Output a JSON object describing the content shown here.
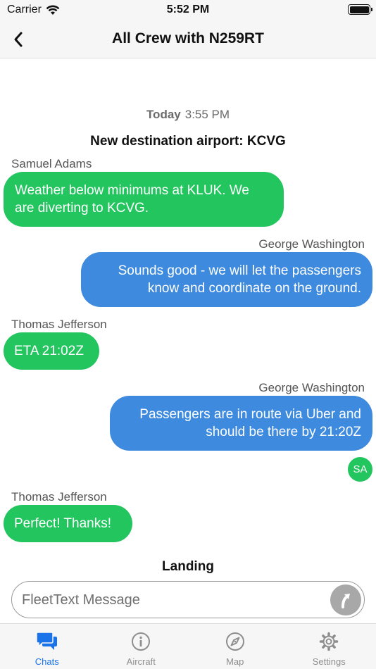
{
  "status": {
    "carrier": "Carrier",
    "time": "5:52 PM",
    "battery_level": 1.0
  },
  "nav": {
    "title": "All Crew with N259RT",
    "back_icon": "chevron-left-icon"
  },
  "chat": {
    "date_day": "Today",
    "date_time": "3:55 PM",
    "event_destination": "New destination airport: KCVG",
    "messages": [
      {
        "sender": "Samuel Adams",
        "side": "left",
        "color": "#22c55e",
        "lines": [
          "Weather below minimums at KLUK. We",
          "are diverting to KCVG."
        ]
      },
      {
        "sender": "George Washington",
        "side": "right",
        "color": "#3d8ade",
        "lines": [
          "Sounds good - we will let the passengers",
          "know and coordinate on the ground."
        ]
      },
      {
        "sender": "Thomas Jefferson",
        "side": "left",
        "color": "#22c55e",
        "lines": [
          "ETA 21:02Z"
        ]
      },
      {
        "sender": "George Washington",
        "side": "right",
        "color": "#3d8ade",
        "lines": [
          "Passengers are in route via Uber and",
          "should be there by 21:20Z"
        ]
      },
      {
        "sender": "Thomas Jefferson",
        "side": "left",
        "color": "#22c55e",
        "lines": [
          "Perfect! Thanks!"
        ]
      }
    ],
    "read_receipt_initials": "SA",
    "event_landing": "Landing"
  },
  "composer": {
    "placeholder": "FleetText Message",
    "send_icon": "send-arrow-icon"
  },
  "tabs": [
    {
      "label": "Chats",
      "icon": "chat-bubbles-icon",
      "active": true
    },
    {
      "label": "Aircraft",
      "icon": "info-circle-icon",
      "active": false
    },
    {
      "label": "Map",
      "icon": "compass-icon",
      "active": false
    },
    {
      "label": "Settings",
      "icon": "gear-icon",
      "active": false
    }
  ],
  "colors": {
    "accent": "#1a73e8",
    "incoming_bubble": "#22c55e",
    "outgoing_bubble": "#3d8ade"
  }
}
